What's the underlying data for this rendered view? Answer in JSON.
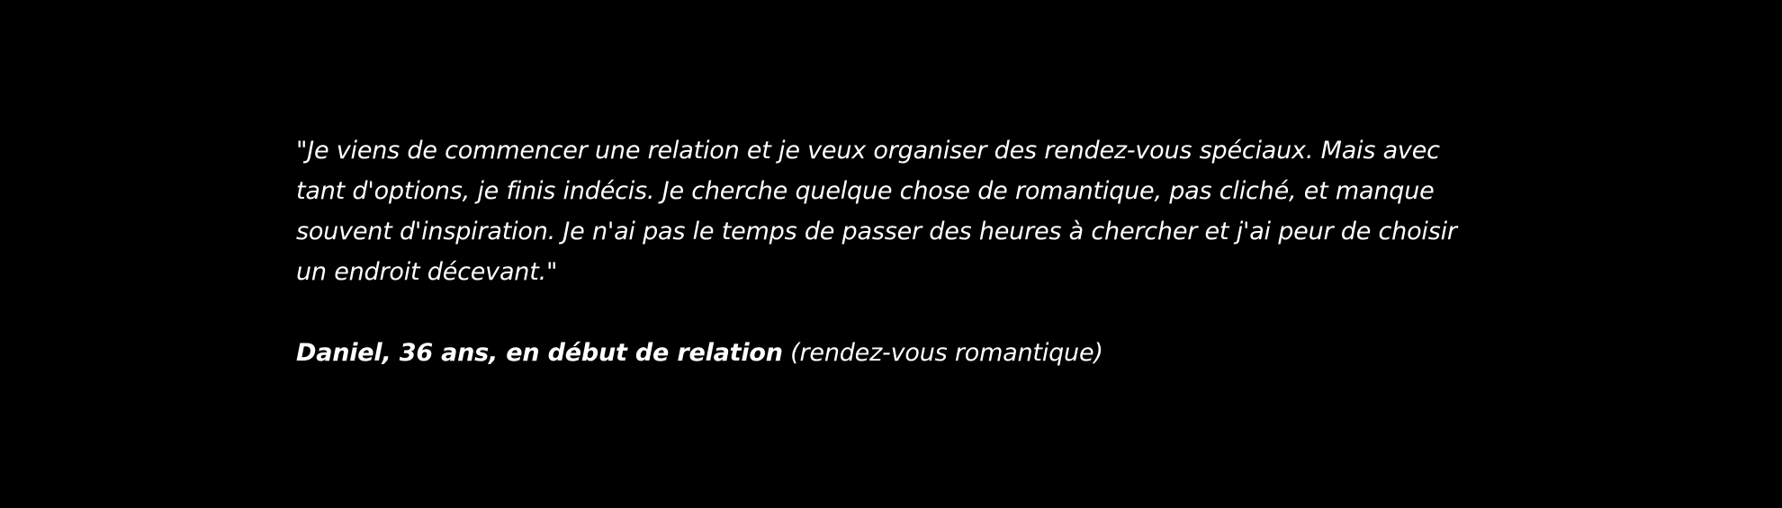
{
  "testimonial": {
    "quote": "\"Je viens de commencer une relation et je veux organiser des rendez-vous spéciaux. Mais avec tant d'options, je finis indécis. Je cherche quelque chose de romantique, pas cliché, et manque souvent d'inspiration. Je n'ai pas le temps de passer des heures à chercher et j'ai peur de choisir un endroit décevant.\"",
    "author": "Daniel, 36 ans, en début de relation",
    "context": "(rendez-vous romantique)"
  },
  "colors": {
    "background": "#000000",
    "text": "#ffffff"
  }
}
